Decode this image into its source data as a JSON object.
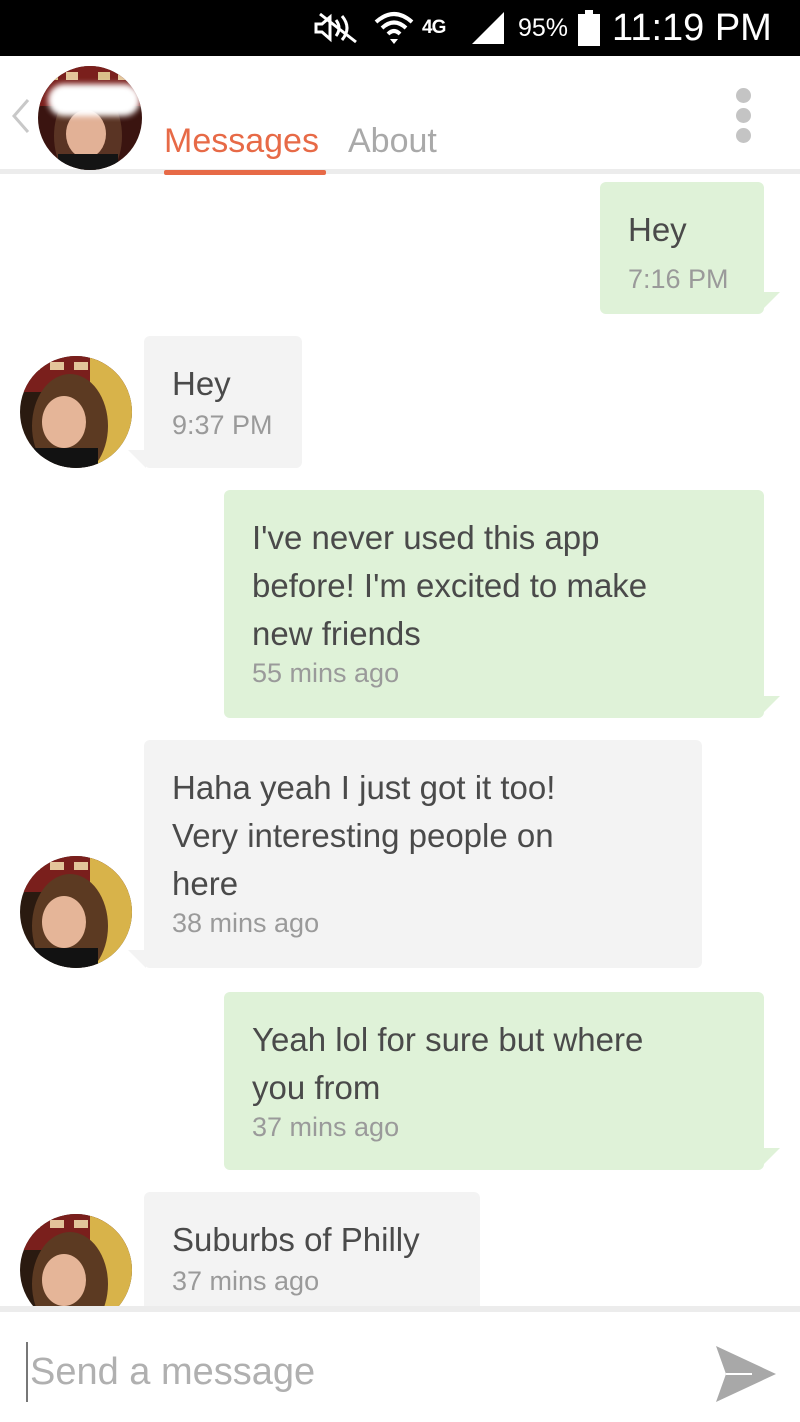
{
  "status_bar": {
    "network": "4G",
    "battery_percent": "95%",
    "time": "11:19 PM"
  },
  "header": {
    "tabs": [
      {
        "label": "Messages",
        "active": true
      },
      {
        "label": "About",
        "active": false
      }
    ]
  },
  "messages": [
    {
      "direction": "out",
      "text": "Hey",
      "time": "7:16 PM"
    },
    {
      "direction": "in",
      "text": "Hey",
      "time": "9:37 PM"
    },
    {
      "direction": "out",
      "text": "I've never used this app\nbefore! I'm excited to make\nnew friends",
      "time": "55 mins ago"
    },
    {
      "direction": "in",
      "text": "Haha yeah I just got it too!\nVery interesting people on\nhere",
      "time": "38 mins ago"
    },
    {
      "direction": "out",
      "text": "Yeah lol for sure but where\nyou from",
      "time": "37 mins ago"
    },
    {
      "direction": "in",
      "text": "Suburbs of Philly",
      "time": "37 mins ago"
    }
  ],
  "composer": {
    "placeholder": "Send a message"
  },
  "colors": {
    "accent": "#e76a47",
    "outgoing_bubble": "#dff2d8",
    "incoming_bubble": "#f3f3f3"
  },
  "icons": {
    "back": "chevron-left-icon",
    "menu": "more-vertical-icon",
    "send": "send-icon",
    "mute": "mute-icon",
    "wifi": "wifi-icon",
    "signal": "signal-icon",
    "battery": "battery-icon"
  }
}
